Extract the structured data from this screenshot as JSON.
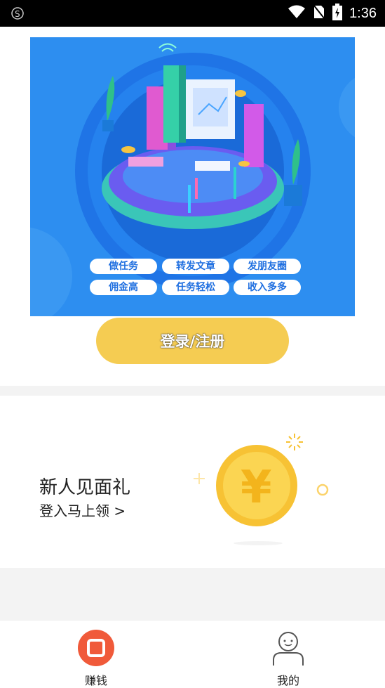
{
  "status_bar": {
    "time": "1:36"
  },
  "hero": {
    "tags": [
      "做任务",
      "转发文章",
      "发朋友圈",
      "佣金高",
      "任务轻松",
      "收入多多"
    ]
  },
  "login_button": {
    "label": "登录/注册"
  },
  "gift": {
    "title": "新人见面礼",
    "subtitle": "登入马上领 >"
  },
  "tabs": [
    {
      "label": "赚钱",
      "icon": "record-stop-icon",
      "active": true,
      "color": "#f05a3a"
    },
    {
      "label": "我的",
      "icon": "user-icon",
      "active": false
    }
  ],
  "colors": {
    "hero_bg": "#2d8ef0",
    "button": "#f5cc52",
    "coin": "#f7c234",
    "active_tab": "#f05a3a"
  }
}
